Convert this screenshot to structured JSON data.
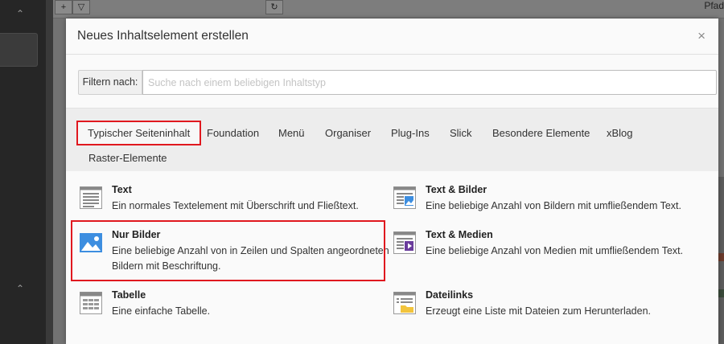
{
  "background": {
    "top_right_text": "Pfad"
  },
  "modal": {
    "title": "Neues Inhaltselement erstellen",
    "close_glyph": "×",
    "filter": {
      "label": "Filtern nach:",
      "placeholder": "Suche nach einem beliebigen Inhaltstyp",
      "value": ""
    },
    "tabs": [
      {
        "label": "Typischer Seiteninhalt",
        "active": true
      },
      {
        "label": "Foundation",
        "active": false
      },
      {
        "label": "Menü",
        "active": false
      },
      {
        "label": "Organiser",
        "active": false
      },
      {
        "label": "Plug-Ins",
        "active": false
      },
      {
        "label": "Slick",
        "active": false
      },
      {
        "label": "Besondere Elemente",
        "active": false
      },
      {
        "label": "xBlog",
        "active": false
      },
      {
        "label": "Raster-Elemente",
        "active": false
      }
    ],
    "items": [
      {
        "title": "Text",
        "description": "Ein normales Textelement mit Überschrift und Fließtext.",
        "icon": "text-icon"
      },
      {
        "title": "Text & Bilder",
        "description": "Eine beliebige Anzahl von Bildern mit umfließendem Text.",
        "icon": "text-images-icon"
      },
      {
        "title": "Nur Bilder",
        "description": "Eine beliebige Anzahl von in Zeilen und Spalten angeordneten Bildern mit Beschriftung.",
        "icon": "images-icon",
        "highlighted": true
      },
      {
        "title": "Text & Medien",
        "description": "Eine beliebige Anzahl von Medien mit umfließendem Text.",
        "icon": "text-media-icon"
      },
      {
        "title": "Tabelle",
        "description": "Eine einfache Tabelle.",
        "icon": "table-icon"
      },
      {
        "title": "Dateilinks",
        "description": "Erzeugt eine Liste mit Dateien zum Herunterladen.",
        "icon": "file-links-icon"
      }
    ]
  },
  "colors": {
    "highlight": "#e0181f",
    "image_icon_blue": "#3d8ee0",
    "media_icon_purple": "#6a3c9c",
    "file_icon_yellow": "#f2c43d"
  }
}
